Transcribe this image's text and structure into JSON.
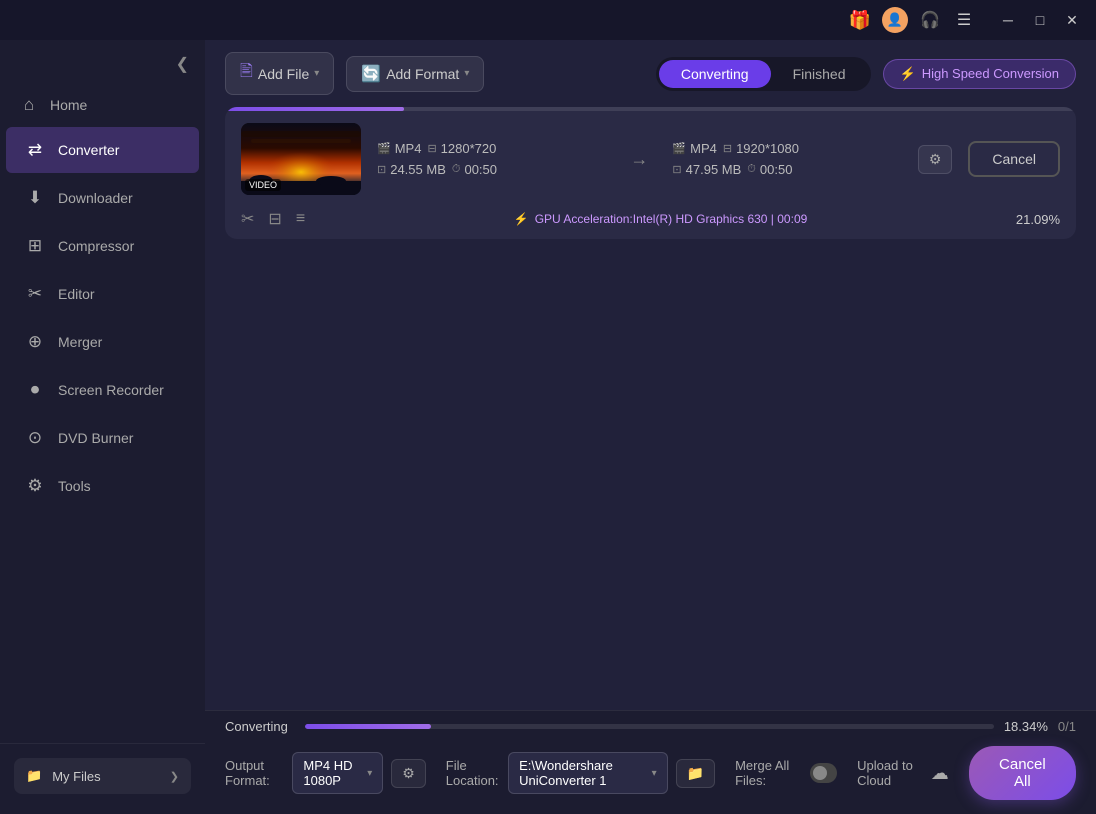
{
  "titlebar": {
    "icons": {
      "gift": "🎁",
      "user": "👤",
      "headphone": "🎧",
      "menu": "☰",
      "minimize": "─",
      "maximize": "□",
      "close": "✕"
    }
  },
  "sidebar": {
    "collapse_icon": "❮",
    "home_label": "Home",
    "home_icon": "⌂",
    "nav_items": [
      {
        "id": "converter",
        "label": "Converter",
        "icon": "⇄",
        "active": true
      },
      {
        "id": "downloader",
        "label": "Downloader",
        "icon": "⬇"
      },
      {
        "id": "compressor",
        "label": "Compressor",
        "icon": "⊞"
      },
      {
        "id": "editor",
        "label": "Editor",
        "icon": "✂"
      },
      {
        "id": "merger",
        "label": "Merger",
        "icon": "⊕"
      },
      {
        "id": "screen_recorder",
        "label": "Screen Recorder",
        "icon": "⏺"
      },
      {
        "id": "dvd_burner",
        "label": "DVD Burner",
        "icon": "⊙"
      },
      {
        "id": "tools",
        "label": "Tools",
        "icon": "⚙"
      }
    ],
    "footer": {
      "my_files_label": "My Files",
      "my_files_icon": "📁",
      "chevron": "❯"
    }
  },
  "toolbar": {
    "add_file_label": "Add File",
    "add_file_chevron": "▾",
    "add_format_label": "Add Format",
    "add_format_chevron": "▾",
    "tabs": [
      {
        "id": "converting",
        "label": "Converting",
        "active": true
      },
      {
        "id": "finished",
        "label": "Finished",
        "active": false
      }
    ],
    "speed_btn_label": "High Speed Conversion",
    "bolt_icon": "⚡"
  },
  "file_card": {
    "thumb_label": "VIDEO",
    "input_format": "MP4",
    "input_resolution": "1280*720",
    "input_size": "24.55 MB",
    "input_duration": "00:50",
    "output_format": "MP4",
    "output_resolution": "1920*1080",
    "output_size": "47.95 MB",
    "output_duration": "00:50",
    "arrow": "→",
    "cancel_btn_label": "Cancel",
    "gpu_info": "GPU Acceleration:Intel(R) HD Graphics 630 | 00:09",
    "progress_pct": "21.09%",
    "progress_fill_pct": 21,
    "card_progress_fill_pct": 21,
    "actions": {
      "cut_icon": "✂",
      "bookmark_icon": "⊟",
      "menu_icon": "≡"
    }
  },
  "bottom_bar": {
    "progress_label": "Converting",
    "progress_pct": "18.34%",
    "progress_fill_pct": 18.34,
    "progress_count": "0/1",
    "output_format_label": "Output Format:",
    "output_format_value": "MP4 HD 1080P",
    "output_format_chevron": "▾",
    "settings_icon": "⚙",
    "file_location_label": "File Location:",
    "file_location_value": "E:\\Wondershare UniConverter 1",
    "file_location_chevron": "▾",
    "folder_icon": "📁",
    "merge_label": "Merge All Files:",
    "toggle_on": false,
    "upload_label": "Upload to Cloud",
    "cloud_icon": "☁",
    "cancel_all_label": "Cancel All"
  }
}
